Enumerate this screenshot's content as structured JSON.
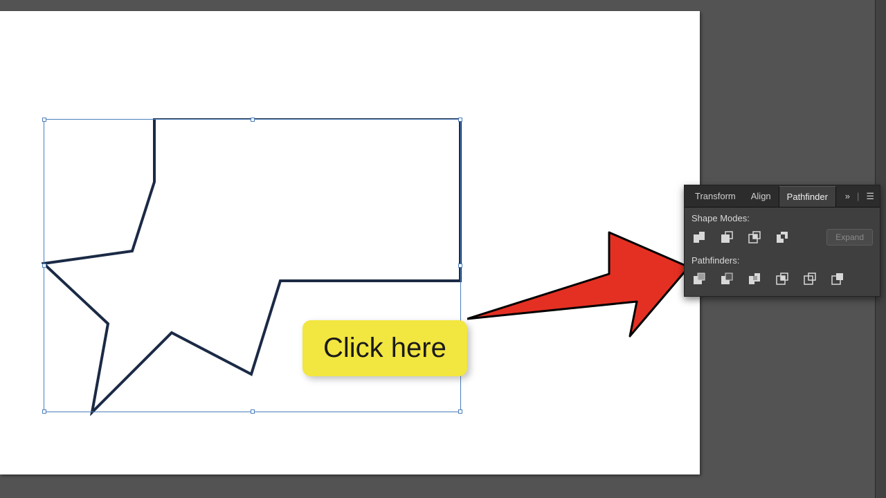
{
  "panel": {
    "tabs": [
      {
        "label": "Transform",
        "active": false
      },
      {
        "label": "Align",
        "active": false
      },
      {
        "label": "Pathfinder",
        "active": true
      }
    ],
    "section_shape_modes": "Shape Modes:",
    "section_pathfinders": "Pathfinders:",
    "expand_label": "Expand",
    "shape_mode_icons": [
      "unite",
      "minus-front",
      "intersect",
      "exclude"
    ],
    "pathfinder_icons": [
      "divide",
      "trim",
      "merge",
      "crop",
      "outline",
      "minus-back"
    ]
  },
  "callout": {
    "text": "Click here"
  },
  "colors": {
    "panel_bg": "#3f3f3f",
    "tab_bg": "#2c2c2c",
    "callout_bg": "#f2e640",
    "arrow_fill": "#e43022",
    "shape_stroke": "#1b2a45",
    "selection": "#4a7ebb"
  }
}
